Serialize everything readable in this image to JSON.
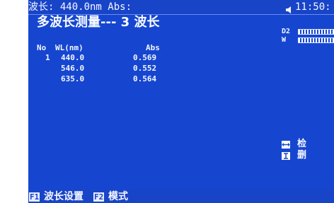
{
  "status_bar": {
    "readout": "波长: 440.0nm Abs:",
    "speaker_icon": "speaker-icon",
    "time": "11:50:"
  },
  "title": "多波长测量--- 3 波长",
  "lamps": {
    "d2_label": "D2",
    "w_label": "W"
  },
  "table": {
    "headers": [
      "No",
      "WL(nm)",
      "Abs"
    ],
    "rows": [
      {
        "no": "1",
        "wl": "440.0",
        "abs": "0.569"
      },
      {
        "no": "",
        "wl": "546.0",
        "abs": "0.552"
      },
      {
        "no": "",
        "wl": "635.0",
        "abs": "0.564"
      }
    ]
  },
  "side_items": [
    {
      "icon": "double-arrow-icon",
      "label": "检"
    },
    {
      "icon": "info-icon",
      "label": "删"
    }
  ],
  "function_keys": [
    {
      "key": "F1",
      "label": "波长设置"
    },
    {
      "key": "F2",
      "label": "模式"
    }
  ],
  "colors": {
    "screen_bg": "#1646d0",
    "text": "#eef3ff"
  }
}
